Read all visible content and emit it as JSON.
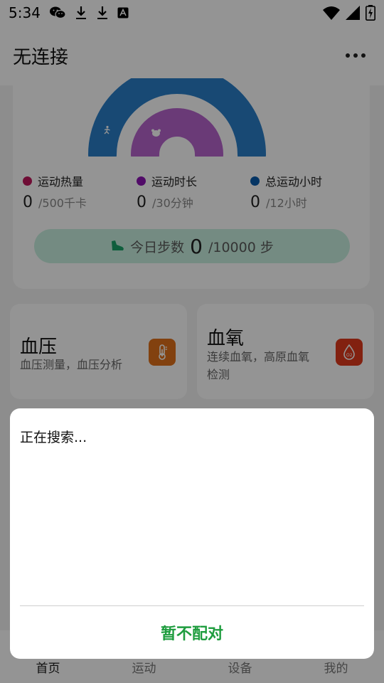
{
  "status_bar": {
    "time": "5:34",
    "left_icons": [
      "wechat-icon",
      "download-icon",
      "download-icon",
      "font-icon"
    ],
    "right_icons": [
      "wifi-icon",
      "signal-icon",
      "battery-charging-icon"
    ]
  },
  "header": {
    "title": "无连接",
    "more_icon": "more-horizontal-icon"
  },
  "activity": {
    "rings": [
      {
        "name": "calories-ring",
        "color": "#2a7fc9",
        "icon": "running-figure-icon",
        "progress": 0
      },
      {
        "name": "duration-ring",
        "color": "#b764ce",
        "icon": "bear-icon",
        "progress": 0
      }
    ],
    "stats": [
      {
        "label": "运动热量",
        "value": "0",
        "goal": "/500千卡",
        "color": "#c0185c"
      },
      {
        "label": "运动时长",
        "value": "0",
        "goal": "/30分钟",
        "color": "#8c13b3"
      },
      {
        "label": "总运动小时",
        "value": "0",
        "goal": "/12小时",
        "color": "#0a5cad"
      }
    ],
    "steps": {
      "icon": "shoe-icon",
      "label": "今日步数",
      "value": "0",
      "goal": "/10000 步"
    }
  },
  "features": [
    {
      "title": "血压",
      "desc": "血压测量，血压分析",
      "icon": "thermometer-icon",
      "color": "#e0701a"
    },
    {
      "title": "血氧",
      "desc_line1": "连续血氧，高原血氧",
      "desc_line2": "检测",
      "icon": "o2-drop-icon",
      "color": "#e03a1c"
    }
  ],
  "nav": {
    "items": [
      "首页",
      "运动",
      "设备",
      "我的"
    ],
    "active_index": 0
  },
  "dialog": {
    "message": "正在搜索...",
    "button": "暂不配对",
    "button_color": "#1f9d3f"
  }
}
